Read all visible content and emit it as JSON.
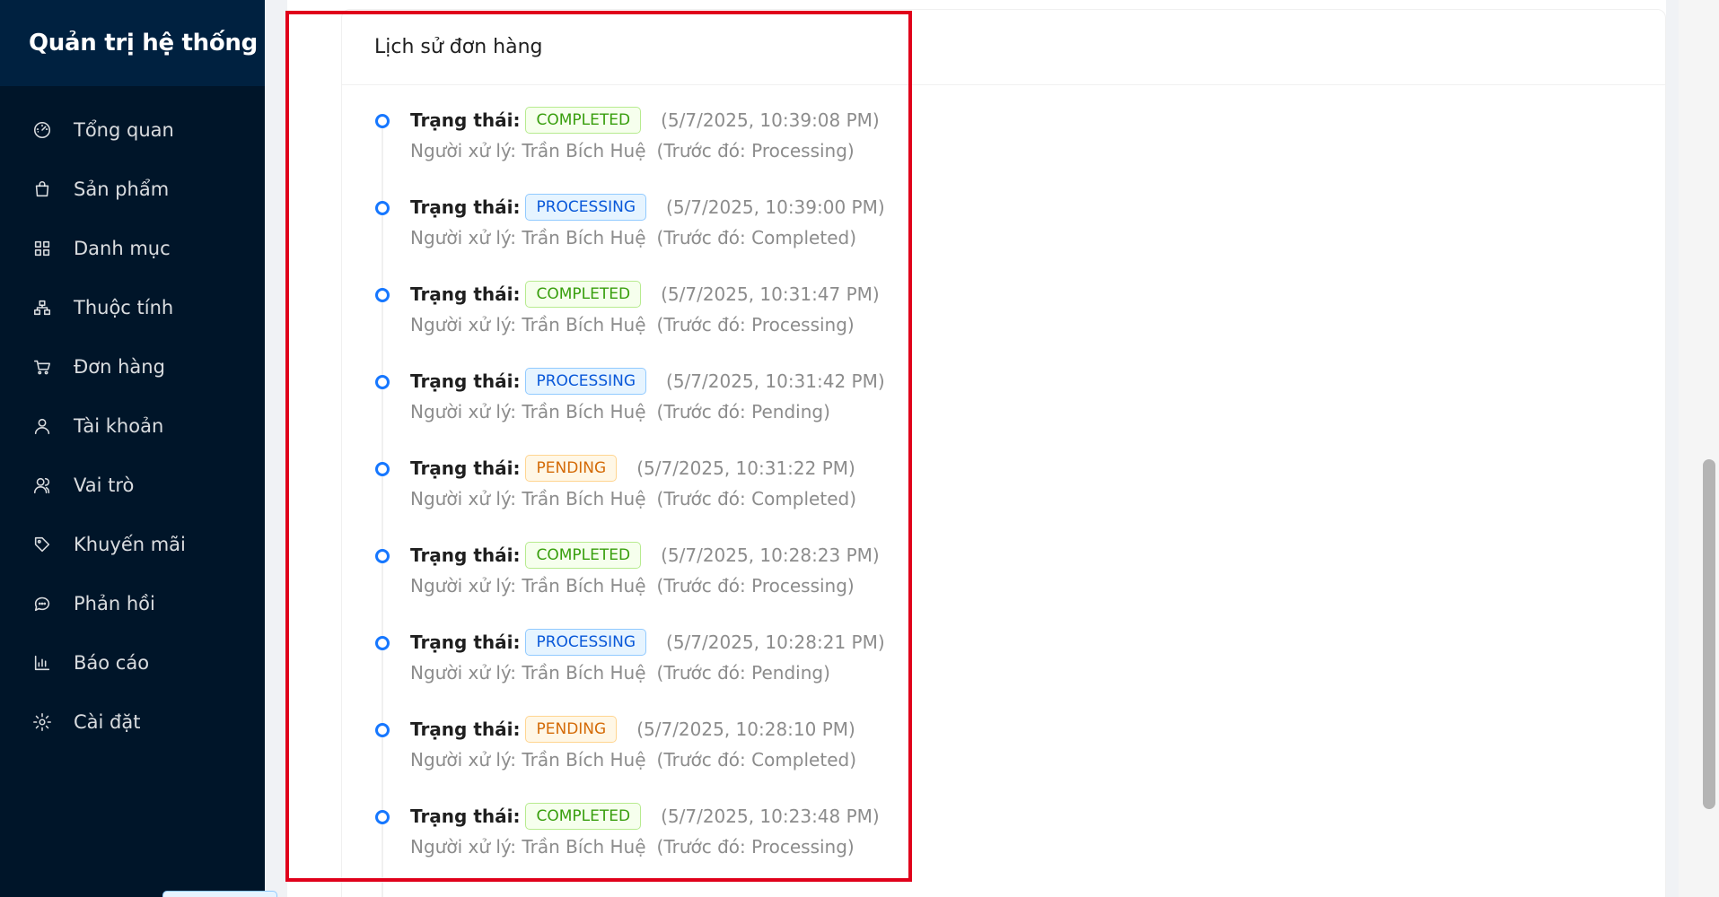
{
  "sidebar": {
    "title": "Quản trị hệ thống",
    "items": [
      {
        "label": "Tổng quan",
        "icon": "dashboard-icon"
      },
      {
        "label": "Sản phẩm",
        "icon": "shopping-bag-icon"
      },
      {
        "label": "Danh mục",
        "icon": "grid-icon"
      },
      {
        "label": "Thuộc tính",
        "icon": "cluster-icon"
      },
      {
        "label": "Đơn hàng",
        "icon": "cart-icon"
      },
      {
        "label": "Tài khoản",
        "icon": "user-icon"
      },
      {
        "label": "Vai trò",
        "icon": "users-icon"
      },
      {
        "label": "Khuyến mãi",
        "icon": "tag-icon"
      },
      {
        "label": "Phản hồi",
        "icon": "comment-icon"
      },
      {
        "label": "Báo cáo",
        "icon": "bar-chart-icon"
      },
      {
        "label": "Cài đặt",
        "icon": "gear-icon"
      }
    ]
  },
  "order_history": {
    "title": "Lịch sử đơn hàng",
    "status_label": "Trạng thái:",
    "handler_label": "Người xử lý:",
    "prev_label": "Trước đó:",
    "entries": [
      {
        "status": "COMPLETED",
        "time": "(5/7/2025, 10:39:08 PM)",
        "handler": "Trần Bích Huệ",
        "prev": "Processing"
      },
      {
        "status": "PROCESSING",
        "time": "(5/7/2025, 10:39:00 PM)",
        "handler": "Trần Bích Huệ",
        "prev": "Completed"
      },
      {
        "status": "COMPLETED",
        "time": "(5/7/2025, 10:31:47 PM)",
        "handler": "Trần Bích Huệ",
        "prev": "Processing"
      },
      {
        "status": "PROCESSING",
        "time": "(5/7/2025, 10:31:42 PM)",
        "handler": "Trần Bích Huệ",
        "prev": "Pending"
      },
      {
        "status": "PENDING",
        "time": "(5/7/2025, 10:31:22 PM)",
        "handler": "Trần Bích Huệ",
        "prev": "Completed"
      },
      {
        "status": "COMPLETED",
        "time": "(5/7/2025, 10:28:23 PM)",
        "handler": "Trần Bích Huệ",
        "prev": "Processing"
      },
      {
        "status": "PROCESSING",
        "time": "(5/7/2025, 10:28:21 PM)",
        "handler": "Trần Bích Huệ",
        "prev": "Pending"
      },
      {
        "status": "PENDING",
        "time": "(5/7/2025, 10:28:10 PM)",
        "handler": "Trần Bích Huệ",
        "prev": "Completed"
      },
      {
        "status": "COMPLETED",
        "time": "(5/7/2025, 10:23:48 PM)",
        "handler": "Trần Bích Huệ",
        "prev": "Processing"
      }
    ]
  },
  "colors": {
    "sidebar_bg": "#001529",
    "brand_bg": "#002140",
    "accent": "#1677ff",
    "highlight": "#e0001b",
    "completed": "#389e0d",
    "processing": "#0958d9",
    "pending": "#d46b08"
  }
}
